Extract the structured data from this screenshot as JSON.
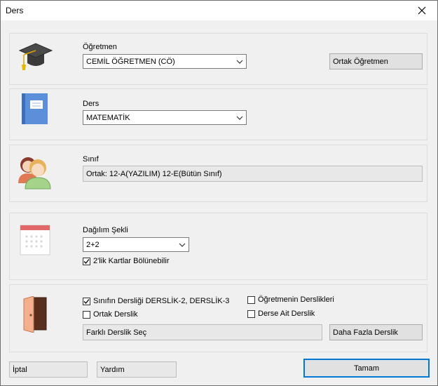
{
  "window": {
    "title": "Ders",
    "close_glyph": "✕"
  },
  "teacher": {
    "label": "Öğretmen",
    "value": "CEMİL ÖĞRETMEN (CÖ)",
    "co_teacher_button": "Ortak Öğretmen",
    "icon": "graduation-cap-icon"
  },
  "course": {
    "label": "Ders",
    "value": "MATEMATİK",
    "icon": "book-icon"
  },
  "class": {
    "label": "Sınıf",
    "value": "Ortak: 12-A(YAZILIM) 12-E(Bütün Sınıf)",
    "icon": "students-icon"
  },
  "distribution": {
    "label": "Dağılım Şekli",
    "value": "2+2",
    "divisible_label": "2'lik Kartlar Bölünebilir",
    "divisible_checked": true,
    "icon": "calendar-icon"
  },
  "classroom": {
    "icon": "door-icon",
    "class_rooms_label": "Sınıfın Dersliği DERSLİK-2, DERSLİK-3",
    "class_rooms_checked": true,
    "shared_room_label": "Ortak Derslik",
    "shared_room_checked": false,
    "teacher_rooms_label": "Öğretmenin Derslikleri",
    "teacher_rooms_checked": false,
    "course_rooms_label": "Derse Ait Derslik",
    "course_rooms_checked": false,
    "select_other_button": "Farklı Derslik Seç",
    "more_rooms_button": "Daha Fazla Derslik"
  },
  "footer": {
    "cancel": "İptal",
    "help": "Yardım",
    "ok": "Tamam"
  }
}
